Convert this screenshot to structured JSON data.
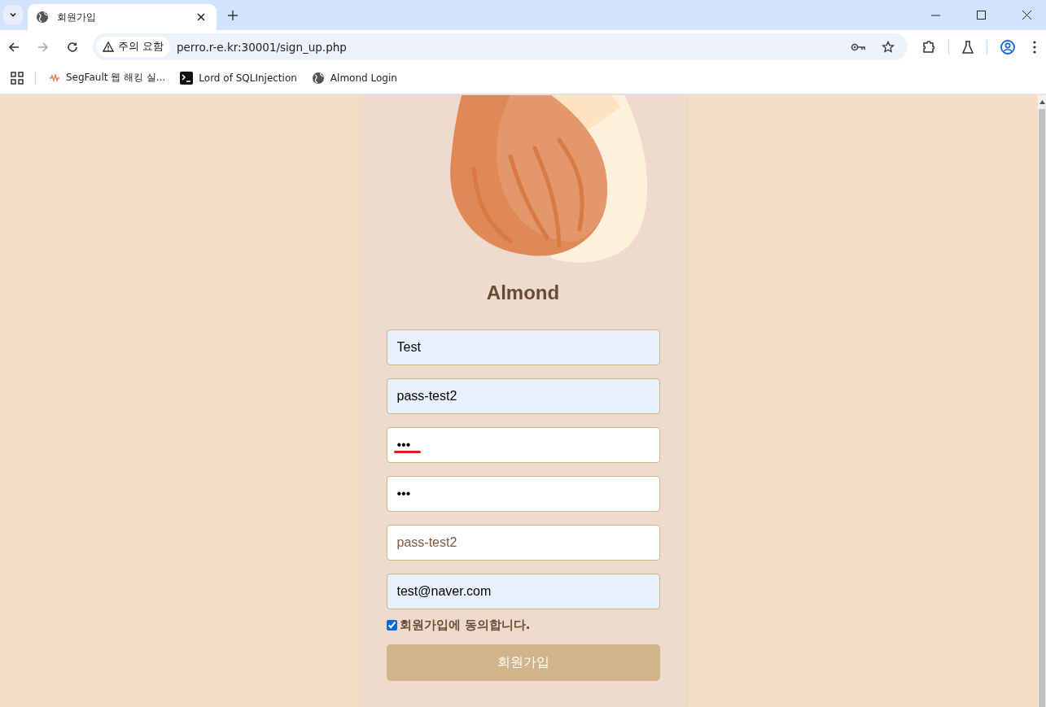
{
  "browser": {
    "tabs": [
      {
        "title": "회원가입",
        "selected": true
      }
    ],
    "security_chip": "주의 요함",
    "url": "perro.r-e.kr:30001/sign_up.php",
    "bookmarks": [
      {
        "label": "SegFault 웹 해킹 실...",
        "kind": "wave"
      },
      {
        "label": "Lord of SQLInjection",
        "kind": "terminal"
      },
      {
        "label": "Almond Login",
        "kind": "globe"
      }
    ]
  },
  "page": {
    "title": "Almond",
    "fields": [
      {
        "value": "Test",
        "autofilled": true,
        "flagged": false
      },
      {
        "value": "pass-test2",
        "autofilled": true,
        "flagged": false
      },
      {
        "value": "•••",
        "autofilled": false,
        "flagged": true
      },
      {
        "value": "•••",
        "autofilled": false,
        "flagged": false
      },
      {
        "placeholder": "pass-test2",
        "autofilled": false,
        "flagged": false
      },
      {
        "value": "test@naver.com",
        "autofilled": true,
        "flagged": false
      }
    ],
    "agree": {
      "label": "회원가입에 동의합니다.",
      "checked": true
    },
    "submit": "회원가입"
  }
}
